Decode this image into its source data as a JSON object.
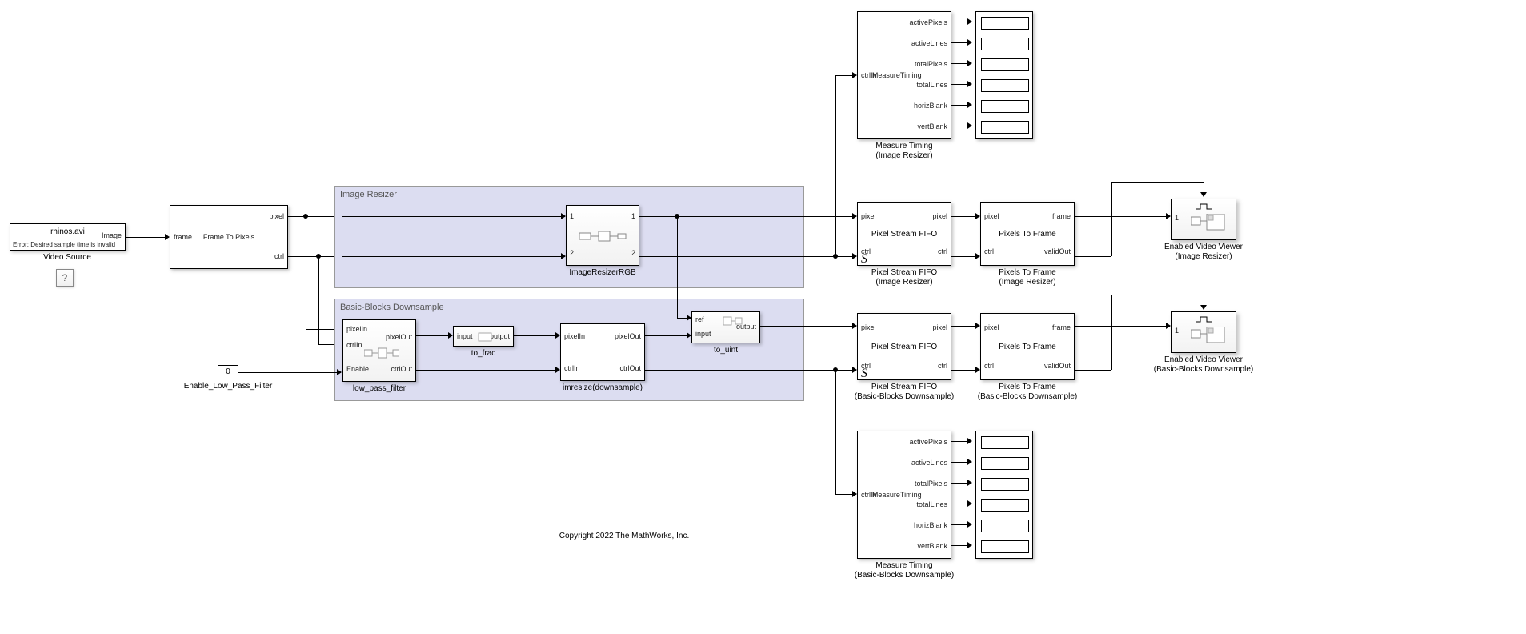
{
  "video_source": {
    "filename": "rhinos.avi",
    "error_line": "Error: Desired sample time is invalid",
    "out_port": "Image",
    "label": "Video Source"
  },
  "question_block": "?",
  "frame_to_pixels": {
    "in": "frame",
    "out_top": "pixel",
    "out_bot": "ctrl",
    "center": "Frame To Pixels"
  },
  "region_resizer_title": "Image Resizer",
  "image_resizer": {
    "p1": "1",
    "p2": "2",
    "o1": "1",
    "o2": "2",
    "label": "ImageResizerRGB"
  },
  "region_downsample_title": "Basic-Blocks Downsample",
  "lpf": {
    "in1": "pixelIn",
    "in2": "ctrlIn",
    "in3": "Enable",
    "out1": "pixelOut",
    "out2": "ctrlOut",
    "label": "low_pass_filter"
  },
  "to_frac": {
    "in": "input",
    "out": "output",
    "label": "to_frac"
  },
  "imresize": {
    "in1": "pixelIn",
    "in2": "ctrlIn",
    "out1": "pixelOut",
    "out2": "ctrlOut",
    "label": "imresize(downsample)"
  },
  "to_uint": {
    "in1": "ref",
    "in2": "input",
    "out": "output",
    "label": "to_uint"
  },
  "enable_const": {
    "value": "0",
    "label": "Enable_Low_Pass_Filter"
  },
  "measure_timing": {
    "in": "ctrlIn",
    "center": "MeasureTiming",
    "out": [
      "activePixels",
      "activeLines",
      "totalPixels",
      "totalLines",
      "horizBlank",
      "vertBlank"
    ],
    "label_top": "Measure Timing",
    "label_top_sub": "(Image Resizer)",
    "label_bot": "Measure Timing",
    "label_bot_sub": "(Basic-Blocks Downsample)"
  },
  "psfifo": {
    "in1": "pixel",
    "in2": "ctrl",
    "out1": "pixel",
    "out2": "ctrl",
    "center": "Pixel Stream FIFO",
    "label_top": "Pixel Stream FIFO",
    "label_top_sub": "(Image Resizer)",
    "label_bot": "Pixel Stream FIFO",
    "label_bot_sub": "(Basic-Blocks Downsample)",
    "s": "S"
  },
  "p2f": {
    "in1": "pixel",
    "in2": "ctrl",
    "out1": "frame",
    "out2": "validOut",
    "center": "Pixels To Frame",
    "label_top": "Pixels To Frame",
    "label_top_sub": "(Image Resizer)",
    "label_bot": "Pixels To Frame",
    "label_bot_sub": "(Basic-Blocks Downsample)"
  },
  "viewer": {
    "port": "1",
    "label_top": "Enabled Video Viewer",
    "label_top_sub": "(Image Resizer)",
    "label_bot": "Enabled Video Viewer",
    "label_bot_sub": "(Basic-Blocks Downsample)"
  },
  "copyright": "Copyright 2022 The MathWorks, Inc."
}
